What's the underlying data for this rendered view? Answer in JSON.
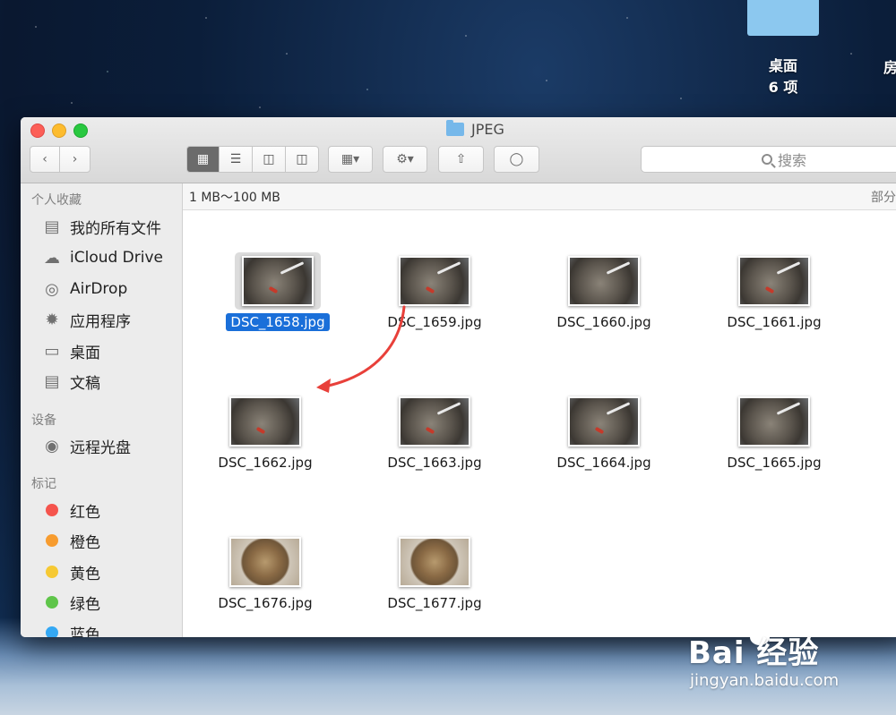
{
  "desktop": {
    "items": [
      {
        "label": "桌面",
        "sub": "6 项"
      },
      {
        "label": "房"
      }
    ]
  },
  "window": {
    "title": "JPEG",
    "search_placeholder": "搜索",
    "path": {
      "size_filter": "1 MB～100 MB",
      "right_label": "部分"
    }
  },
  "sidebar": {
    "sections": {
      "favorites": "个人收藏",
      "devices": "设备",
      "tags": "标记"
    },
    "favorites": [
      "我的所有文件",
      "iCloud Drive",
      "AirDrop",
      "应用程序",
      "桌面",
      "文稿"
    ],
    "devices": [
      "远程光盘"
    ],
    "tags": [
      {
        "label": "红色",
        "color": "#f5544d"
      },
      {
        "label": "橙色",
        "color": "#f79c2f"
      },
      {
        "label": "黄色",
        "color": "#f6c934"
      },
      {
        "label": "绿色",
        "color": "#5fc54a"
      },
      {
        "label": "蓝色",
        "color": "#34a8f4"
      }
    ]
  },
  "files": [
    {
      "name": "DSC_1658.jpg",
      "selected": true
    },
    {
      "name": "DSC_1659.jpg"
    },
    {
      "name": "DSC_1660.jpg"
    },
    {
      "name": "DSC_1661.jpg"
    },
    {
      "name": "DSC_1662.jpg"
    },
    {
      "name": "DSC_1663.jpg"
    },
    {
      "name": "DSC_1664.jpg"
    },
    {
      "name": "DSC_1665.jpg"
    },
    {
      "name": "DSC_1676.jpg"
    },
    {
      "name": "DSC_1677.jpg"
    }
  ],
  "watermark": {
    "brand": "Bai  经验",
    "url": "jingyan.baidu.com"
  },
  "colors": {
    "selection": "#1a6fd9",
    "annotation_arrow": "#e8403a"
  }
}
